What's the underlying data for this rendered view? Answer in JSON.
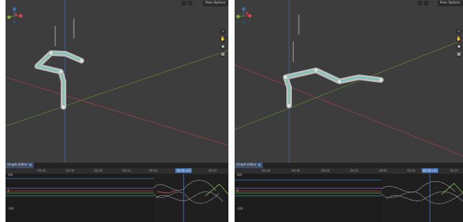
{
  "left": {
    "pose_options": "Pose Options",
    "editor_label": "Graph Editor",
    "ticks": [
      "-00:40",
      "-00:30",
      "-00:20",
      "-00:10",
      "00:00",
      "00:10",
      "00:20"
    ],
    "current_frame": "00:00+23",
    "y_labels": [
      "100",
      "0",
      "-100"
    ]
  },
  "right": {
    "pose_options": "Pose Options",
    "editor_label": "Graph Editor",
    "ticks": [
      "-00:40",
      "-00:30",
      "-00:20",
      "-00:10",
      "00:00",
      "00:10",
      "00:20"
    ],
    "current_frame": "00:00+14",
    "y_labels": [
      "100",
      "0",
      "-100"
    ]
  },
  "colors": {
    "viewport_bg": "#3d3d3d",
    "grid_red_axis": "#a33f4c",
    "grid_green_axis": "#5f8a2e",
    "grid_blue_axis": "#3e6fb0",
    "bone_body": "#bdbdbd",
    "bone_selected": "#3fd1b4",
    "playhead": "#4772b3"
  },
  "icons": [
    "axis-gizmo-icon",
    "zoom-icon",
    "hand-icon",
    "camera-icon",
    "grid-icon"
  ]
}
